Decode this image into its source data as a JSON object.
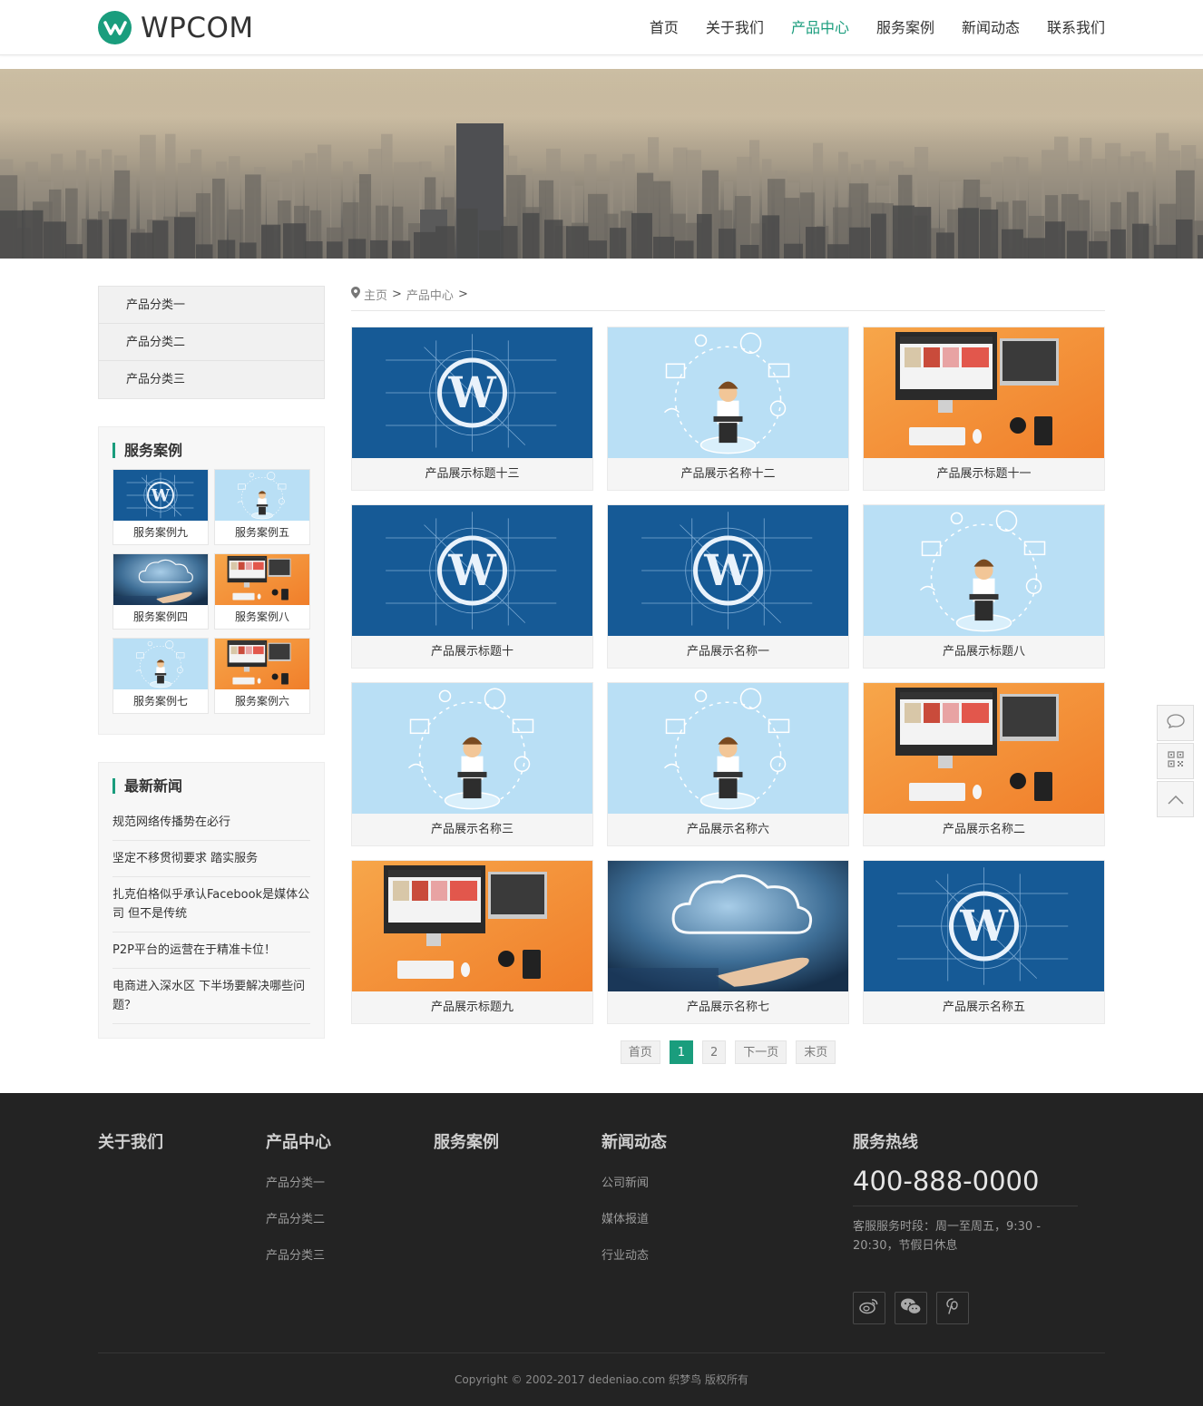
{
  "brand": {
    "name": "WPCOM",
    "accent": "#1a9d7d"
  },
  "nav": [
    {
      "label": "首页",
      "active": false
    },
    {
      "label": "关于我们",
      "active": false
    },
    {
      "label": "产品中心",
      "active": true
    },
    {
      "label": "服务案例",
      "active": false
    },
    {
      "label": "新闻动态",
      "active": false
    },
    {
      "label": "联系我们",
      "active": false
    }
  ],
  "sidebar": {
    "categories": [
      "产品分类一",
      "产品分类二",
      "产品分类三"
    ],
    "cases_title": "服务案例",
    "cases": [
      {
        "label": "服务案例九",
        "img": "wp"
      },
      {
        "label": "服务案例五",
        "img": "boy"
      },
      {
        "label": "服务案例四",
        "img": "cloud"
      },
      {
        "label": "服务案例八",
        "img": "desk"
      },
      {
        "label": "服务案例七",
        "img": "boy"
      },
      {
        "label": "服务案例六",
        "img": "desk"
      }
    ],
    "news_title": "最新新闻",
    "news": [
      "规范网络传播势在必行",
      "坚定不移贯彻要求 踏实服务",
      "扎克伯格似乎承认Facebook是媒体公司 但不是传统",
      "P2P平台的运营在于精准卡位！",
      "电商进入深水区 下半场要解决哪些问题？"
    ]
  },
  "breadcrumb": {
    "home": "主页",
    "sep": ">",
    "current": "产品中心"
  },
  "products": [
    {
      "title": "产品展示标题十三",
      "img": "wp"
    },
    {
      "title": "产品展示名称十二",
      "img": "boy"
    },
    {
      "title": "产品展示标题十一",
      "img": "desk"
    },
    {
      "title": "产品展示标题十",
      "img": "wp"
    },
    {
      "title": "产品展示名称一",
      "img": "wp"
    },
    {
      "title": "产品展示标题八",
      "img": "boy"
    },
    {
      "title": "产品展示名称三",
      "img": "boy"
    },
    {
      "title": "产品展示名称六",
      "img": "boy"
    },
    {
      "title": "产品展示名称二",
      "img": "desk"
    },
    {
      "title": "产品展示标题九",
      "img": "desk"
    },
    {
      "title": "产品展示名称七",
      "img": "cloud"
    },
    {
      "title": "产品展示名称五",
      "img": "wp"
    }
  ],
  "pagination": {
    "first": "首页",
    "pages": [
      "1",
      "2"
    ],
    "current": "1",
    "next": "下一页",
    "last": "末页"
  },
  "footer": {
    "about": "关于我们",
    "products_title": "产品中心",
    "product_links": [
      "产品分类一",
      "产品分类二",
      "产品分类三"
    ],
    "cases": "服务案例",
    "news_title": "新闻动态",
    "news_links": [
      "公司新闻",
      "媒体报道",
      "行业动态"
    ],
    "hotline_title": "服务热线",
    "hotline": "400-888-0000",
    "hotline_desc": "客服服务时段：周一至周五，9:30 - 20:30，节假日休息",
    "copyright": "Copyright © 2002-2017 dedeniao.com 织梦鸟 版权所有"
  },
  "icons": {
    "float": [
      "chat-icon",
      "qrcode-icon",
      "arrow-up-icon"
    ],
    "social": [
      "weibo-icon",
      "wechat-icon",
      "pinterest-icon"
    ]
  }
}
